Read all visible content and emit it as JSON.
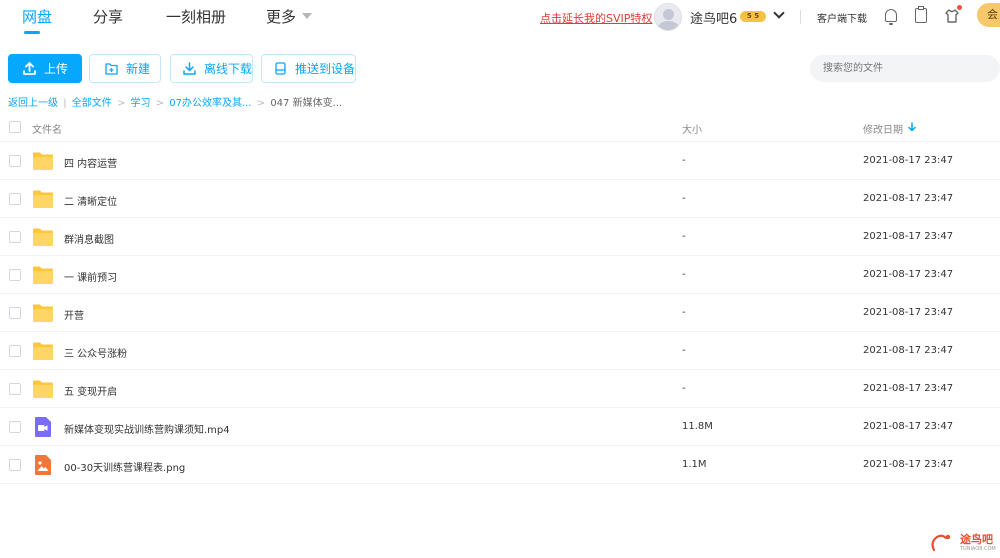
{
  "nav": {
    "tabs": [
      {
        "label": "网盘"
      },
      {
        "label": "分享"
      },
      {
        "label": "一刻相册"
      },
      {
        "label": "更多"
      }
    ]
  },
  "header": {
    "svip_link": "点击延长我的SVIP特权",
    "username": "途鸟吧6",
    "vip_badge": "5 5",
    "client_download": "客户端下载",
    "gold_label": "会"
  },
  "toolbar": {
    "upload": "上传",
    "new": "新建",
    "offline_download": "离线下载",
    "push_to_device": "推送到设备",
    "search_placeholder": "搜索您的文件"
  },
  "breadcrumb": {
    "back": "返回上一级",
    "sep1": "|",
    "items": [
      "全部文件",
      "学习",
      "07办公效率及其...",
      "047 新媒体变..."
    ],
    "sep": ">"
  },
  "table": {
    "columns": {
      "name": "文件名",
      "size": "大小",
      "date": "修改日期"
    },
    "rows": [
      {
        "name": "四 内容运营",
        "size": "-",
        "date": "2021-08-17 23:47",
        "type": "folder"
      },
      {
        "name": "二 清晰定位",
        "size": "-",
        "date": "2021-08-17 23:47",
        "type": "folder"
      },
      {
        "name": "群消息截图",
        "size": "-",
        "date": "2021-08-17 23:47",
        "type": "folder"
      },
      {
        "name": "一 课前预习",
        "size": "-",
        "date": "2021-08-17 23:47",
        "type": "folder"
      },
      {
        "name": "开营",
        "size": "-",
        "date": "2021-08-17 23:47",
        "type": "folder"
      },
      {
        "name": "三 公众号涨粉",
        "size": "-",
        "date": "2021-08-17 23:47",
        "type": "folder"
      },
      {
        "name": "五 变现开启",
        "size": "-",
        "date": "2021-08-17 23:47",
        "type": "folder"
      },
      {
        "name": "新媒体变现实战训练营购课须知.mp4",
        "size": "11.8M",
        "date": "2021-08-17 23:47",
        "type": "video"
      },
      {
        "name": "00-30天训练营课程表.png",
        "size": "1.1M",
        "date": "2021-08-17 23:47",
        "type": "image"
      }
    ]
  },
  "watermark": {
    "text": "途鸟吧",
    "sub": "TUNIAO8.COM"
  },
  "colors": {
    "accent": "#06a7ff",
    "folder": "#ffc53d",
    "video": "#7b6cf6",
    "image": "#f2763c",
    "link_red": "#e53935"
  }
}
